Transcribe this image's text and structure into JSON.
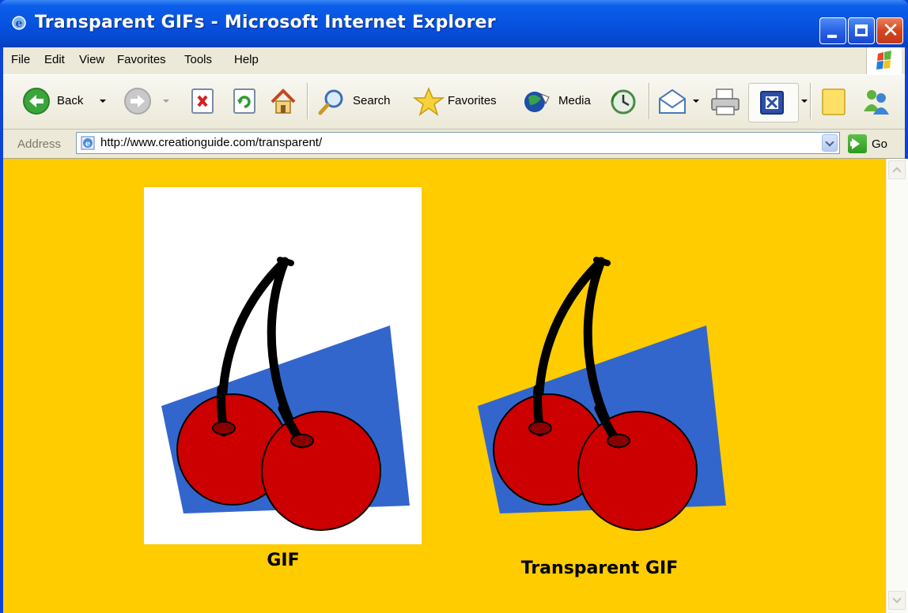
{
  "window": {
    "title": "Transparent GIFs - Microsoft Internet Explorer",
    "close_glyph": "✕"
  },
  "menu": {
    "items": [
      "File",
      "Edit",
      "View",
      "Favorites",
      "Tools",
      "Help"
    ]
  },
  "toolbar": {
    "back_label": "Back",
    "search_label": "Search",
    "favorites_label": "Favorites",
    "media_label": "Media"
  },
  "address": {
    "label": "Address",
    "url": "http://www.creationguide.com/transparent/",
    "go_label": "Go"
  },
  "content": {
    "background_color": "#ffcc00",
    "captions": {
      "gif": "GIF",
      "transparent_gif": "Transparent GIF"
    }
  },
  "colors": {
    "title_bar": "#0653e0",
    "chrome": "#ece9d8",
    "cherry_red": "#cc0000",
    "shape_blue": "#3366cc"
  }
}
